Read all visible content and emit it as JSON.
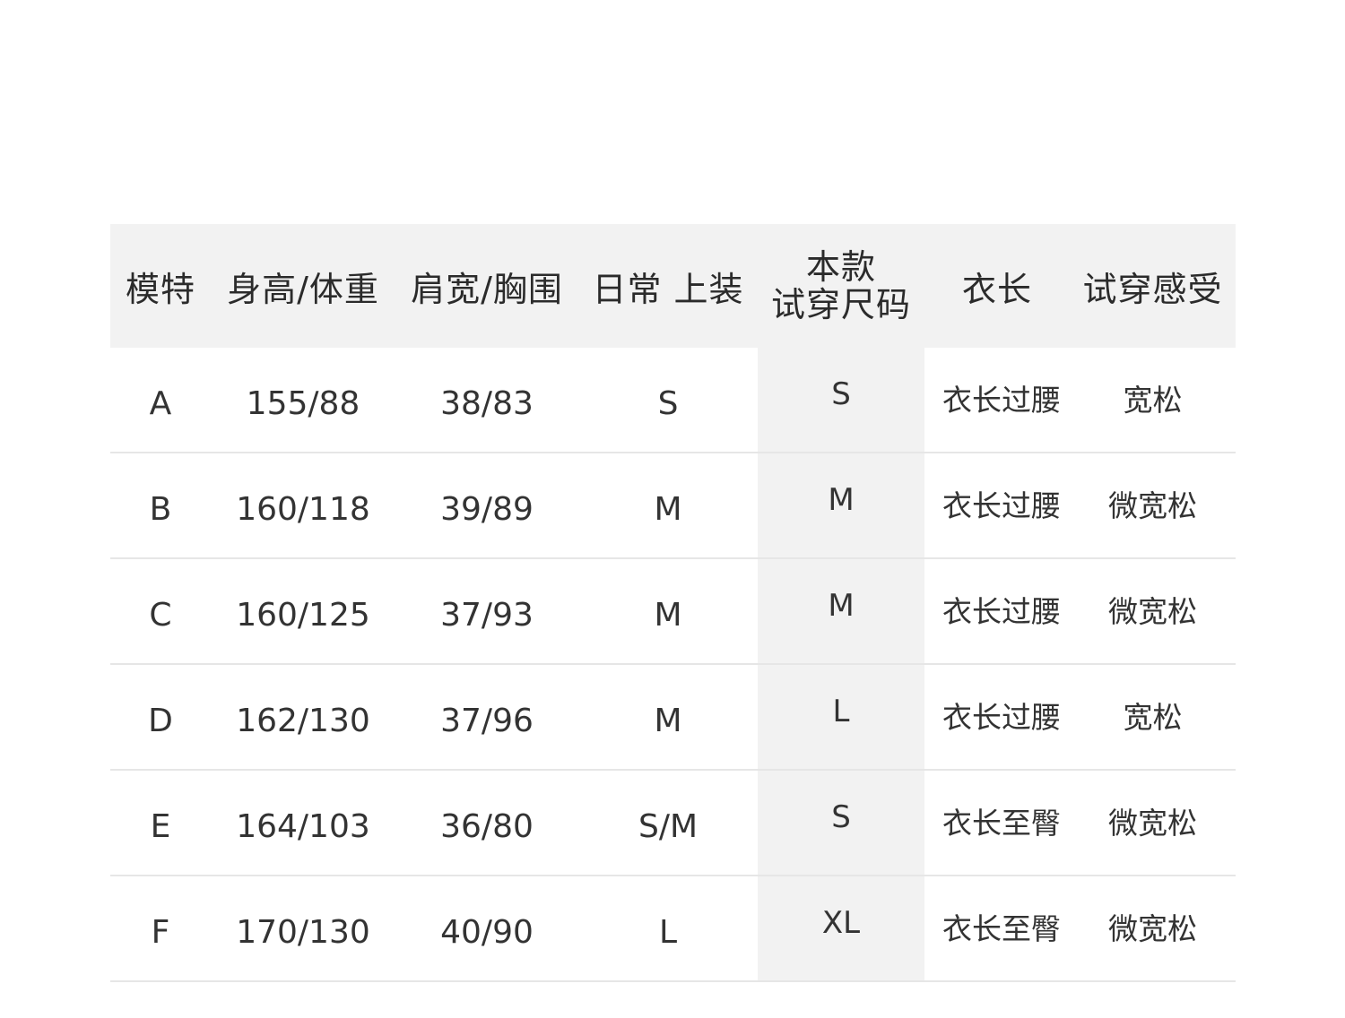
{
  "table": {
    "headers": [
      "模特",
      "身高/体重",
      "肩宽/胸围",
      "日常 上装",
      "本款",
      "试穿尺码",
      "衣长",
      "试穿感受"
    ],
    "rows": [
      [
        "A",
        "155/88",
        "38/83",
        "S",
        "S",
        "衣长过腰",
        "宽松"
      ],
      [
        "B",
        "160/118",
        "39/89",
        "M",
        "M",
        "衣长过腰",
        "微宽松"
      ],
      [
        "C",
        "160/125",
        "37/93",
        "M",
        "M",
        "衣长过腰",
        "微宽松"
      ],
      [
        "D",
        "162/130",
        "37/96",
        "M",
        "L",
        "衣长过腰",
        "宽松"
      ],
      [
        "E",
        "164/103",
        "36/80",
        "S/M",
        "S",
        "衣长至臀",
        "微宽松"
      ],
      [
        "F",
        "170/130",
        "40/90",
        "L",
        "XL",
        "衣长至臀",
        "微宽松"
      ]
    ]
  },
  "colors": {
    "header_bg": "#f2f2f2",
    "highlight_column_bg": "#f2f2f2",
    "row_divider": "#e6e6e6",
    "text": "#333333"
  }
}
